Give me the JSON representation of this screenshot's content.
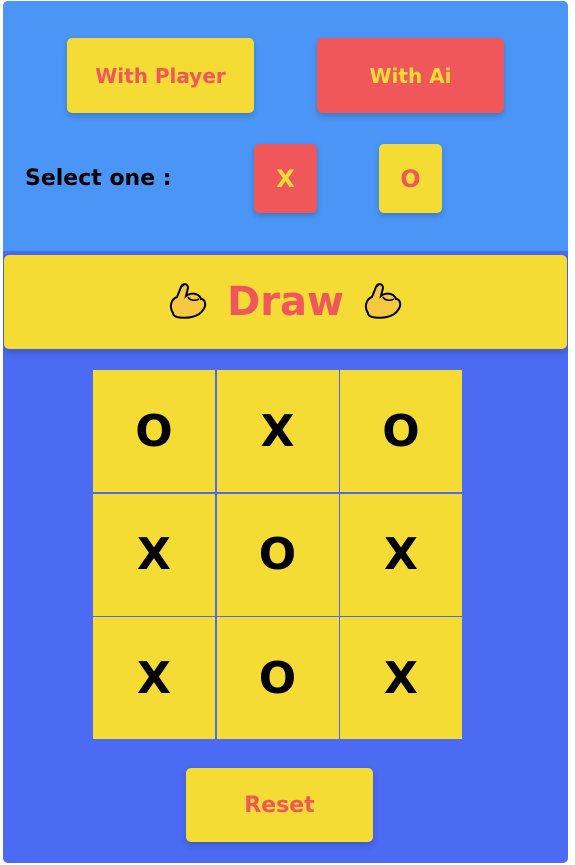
{
  "mode": {
    "player_label": "With Player",
    "ai_label": "With Ai"
  },
  "select": {
    "label": "Select one :",
    "x_label": "X",
    "o_label": "O"
  },
  "status": {
    "text": "Draw",
    "left_icon": "flexed-biceps-icon",
    "right_icon": "flexed-biceps-icon"
  },
  "board": {
    "cells": [
      "O",
      "X",
      "O",
      "X",
      "O",
      "X",
      "X",
      "O",
      "X"
    ]
  },
  "controls": {
    "reset_label": "Reset"
  },
  "colors": {
    "top_panel": "#4a95f5",
    "background": "#4a6bf2",
    "yellow": "#f5dc34",
    "red": "#f0575a"
  }
}
